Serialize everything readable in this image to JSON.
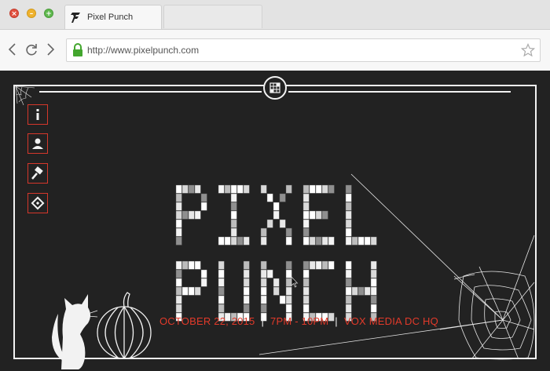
{
  "browser": {
    "tab_title": "Pixel Punch",
    "url": "http://www.pixelpunch.com",
    "window_controls": [
      "close",
      "minimize",
      "maximize"
    ],
    "nav_icons": [
      "back-arrow-icon",
      "reload-icon",
      "forward-arrow-icon",
      "lock-icon",
      "bookmark-star-icon"
    ]
  },
  "page": {
    "logo_text": [
      "PIXEL",
      "PUNCH"
    ],
    "event": {
      "date": "OCTOBER 22, 2015",
      "time": "7PM - 10PM",
      "venue": "VOX MEDIA DC HQ"
    },
    "sidebar": [
      {
        "icon": "info-icon"
      },
      {
        "icon": "person-icon"
      },
      {
        "icon": "gavel-icon"
      },
      {
        "icon": "ticket-icon"
      }
    ],
    "colors": {
      "background": "#222222",
      "frame": "#f2f2f2",
      "accent_red": "#e23a2a"
    }
  }
}
